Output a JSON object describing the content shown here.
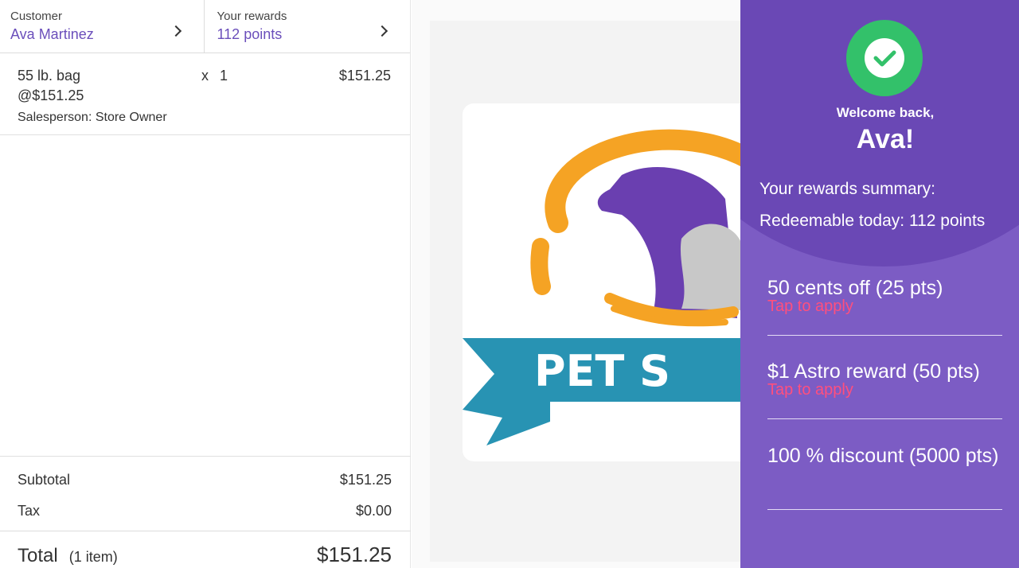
{
  "header": {
    "customer_label": "Customer",
    "customer_name": "Ava Martinez",
    "rewards_label": "Your rewards",
    "rewards_value": "112 points"
  },
  "cart": {
    "items": [
      {
        "name": "55 lb. bag",
        "unit_price": "@$151.25",
        "salesperson": "Salesperson: Store Owner",
        "x": "x",
        "qty": "1",
        "total": "$151.25"
      }
    ]
  },
  "summary": {
    "subtotal_label": "Subtotal",
    "subtotal": "$151.25",
    "tax_label": "Tax",
    "tax": "$0.00",
    "total_label": "Total",
    "item_count": "(1 item)",
    "total": "$151.25"
  },
  "logo": {
    "text": "PET S",
    "colors": {
      "orange": "#f5a324",
      "purple": "#6a3fb0",
      "teal": "#2893b3",
      "gray": "#c8c8c8"
    }
  },
  "panel": {
    "bg_color": "#7c5cc4",
    "check_color": "#33c16a",
    "welcome": "Welcome back,",
    "name": "Ava!",
    "summary_title": "Your rewards summary:",
    "redeemable": "Redeemable today: 112 points",
    "rewards": [
      {
        "title": "50 cents off (25 pts)",
        "action": "Tap to apply"
      },
      {
        "title": "$1 Astro reward (50 pts)",
        "action": "Tap to apply"
      },
      {
        "title": "100 % discount (5000 pts)",
        "action": ""
      }
    ]
  }
}
